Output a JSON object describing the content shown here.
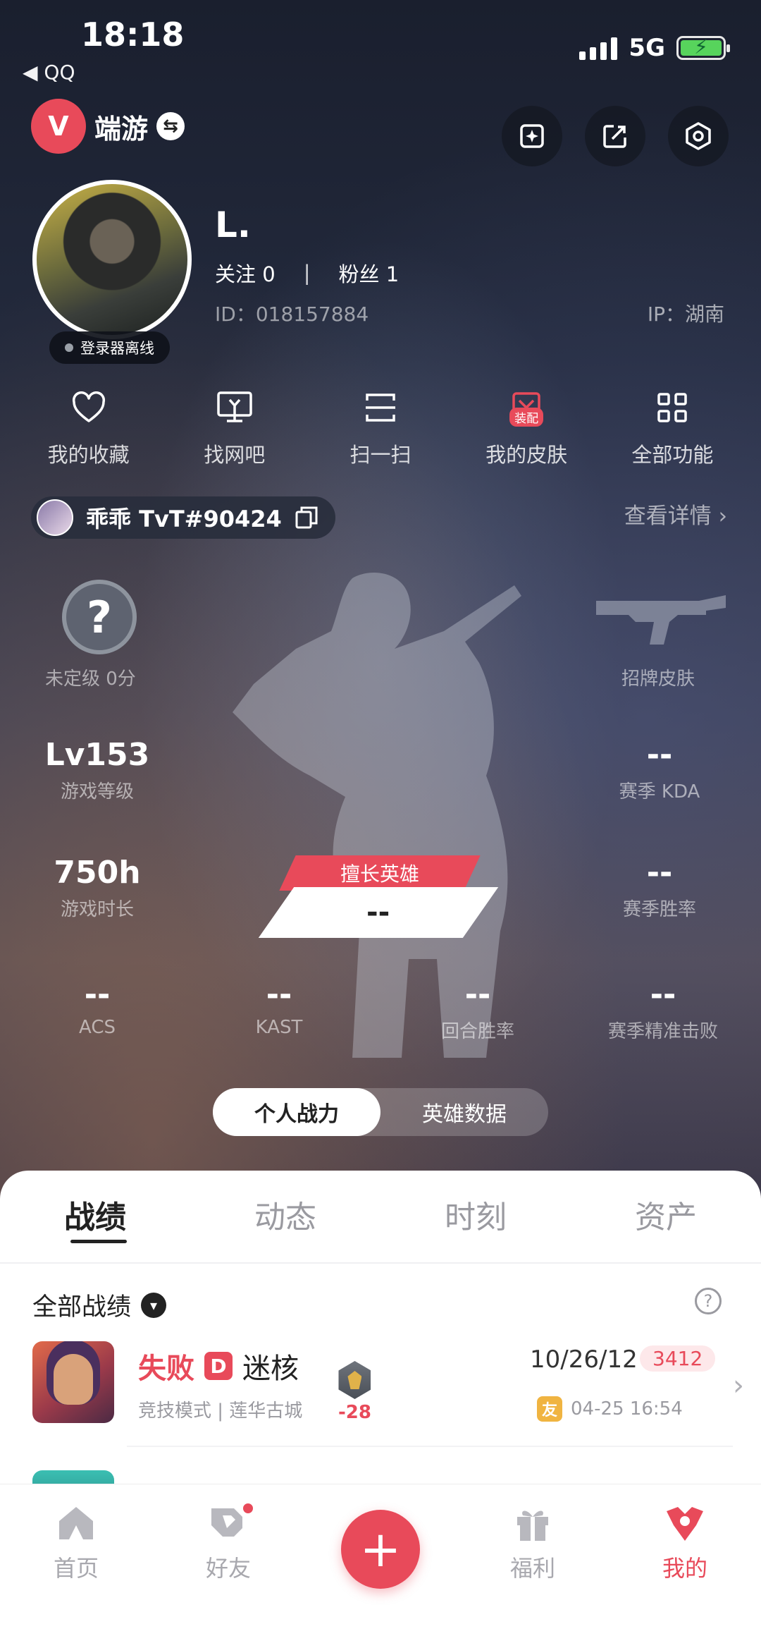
{
  "status_bar": {
    "time": "18:18",
    "back_label": "◀ QQ",
    "network": "5G"
  },
  "header": {
    "app_name": "端游",
    "app_logo_letter": "V"
  },
  "profile": {
    "username": "L.",
    "following_label": "关注",
    "following_count": "0",
    "followers_label": "粉丝",
    "followers_count": "1",
    "user_id": "ID：018157884",
    "ip_location": "IP：湖南",
    "login_status": "登录器离线"
  },
  "features": [
    {
      "label": "我的收藏",
      "icon": "heart-icon"
    },
    {
      "label": "找网吧",
      "icon": "monitor-icon"
    },
    {
      "label": "扫一扫",
      "icon": "scan-icon"
    },
    {
      "label": "我的皮肤",
      "icon": "skin-icon",
      "badge": "装配"
    },
    {
      "label": "全部功能",
      "icon": "grid-icon"
    }
  ],
  "game_account": {
    "name": "乖乖 TvT#90424",
    "detail_link": "查看详情"
  },
  "stats": {
    "rank_symbol": "?",
    "rank_label": "未定级 0分",
    "signature_skin_label": "招牌皮肤",
    "level_value": "Lv153",
    "level_label": "游戏等级",
    "kda_value": "--",
    "kda_label": "赛季 KDA",
    "hours_value": "750h",
    "hours_label": "游戏时长",
    "winrate_value": "--",
    "winrate_label": "赛季胜率",
    "fav_hero_tag": "擅长英雄",
    "fav_hero_value": "--",
    "acs_value": "--",
    "acs_label": "ACS",
    "kast_value": "--",
    "kast_label": "KAST",
    "round_win_value": "--",
    "round_win_label": "回合胜率",
    "precision_value": "--",
    "precision_label": "赛季精准击败"
  },
  "stat_toggle": {
    "personal_label": "个人战力",
    "hero_label": "英雄数据"
  },
  "sheet": {
    "tabs": [
      "战绩",
      "动态",
      "时刻",
      "资产"
    ],
    "filter_label": "全部战绩",
    "help_symbol": "?"
  },
  "match": {
    "result": "失败",
    "grade": "D",
    "map": "迷核",
    "mode_line": "竞技模式 | 莲华古城",
    "rank_delta": "-28",
    "kda": "10/26/12",
    "score": "3412",
    "friend_badge": "友",
    "time": "04-25 16:54"
  },
  "nav": {
    "home_label": "首页",
    "friends_label": "好友",
    "create_symbol": "+",
    "welfare_label": "福利",
    "me_label": "我的"
  },
  "colors": {
    "accent": "#e84a5a",
    "battery": "#57d45c",
    "friend_badge": "#f0b441"
  }
}
